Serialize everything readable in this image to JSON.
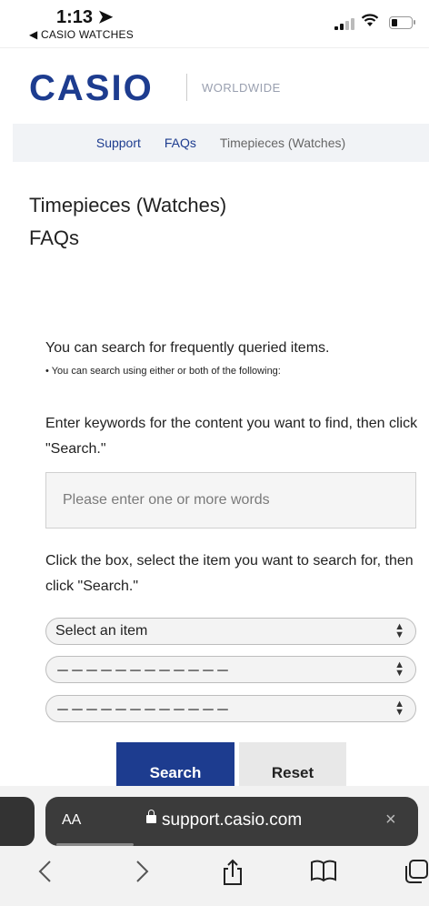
{
  "status_bar": {
    "time": "1:13",
    "back_app": "◀ CASIO WATCHES"
  },
  "header": {
    "logo": "CASIO",
    "region": "WORLDWIDE"
  },
  "breadcrumb": [
    {
      "label": "Support"
    },
    {
      "label": "FAQs"
    },
    {
      "label": "Timepieces (Watches)"
    }
  ],
  "page_title": {
    "line1": "Timepieces (Watches)",
    "line2": "FAQs"
  },
  "search": {
    "intro": "You can search for frequently queried items.",
    "note": "• You can search using either or both of the following:",
    "keyword_instruction": "Enter keywords for the content you want to find, then click \"Search.\"",
    "keyword_placeholder": "Please enter one or more words",
    "select_instruction": "Click the box, select the item you want to search for, then click \"Search.\"",
    "selects": [
      {
        "value": "Select an item"
      },
      {
        "value": "－－－－－－－－－－－－"
      },
      {
        "value": "－－－－－－－－－－－－"
      }
    ],
    "search_label": "Search",
    "reset_label": "Reset"
  },
  "browser": {
    "text_size_label": "AA",
    "url": "support.casio.com",
    "close_glyph": "×",
    "icons": [
      "back-icon",
      "forward-icon",
      "share-icon",
      "bookmarks-icon",
      "tabs-icon"
    ]
  }
}
